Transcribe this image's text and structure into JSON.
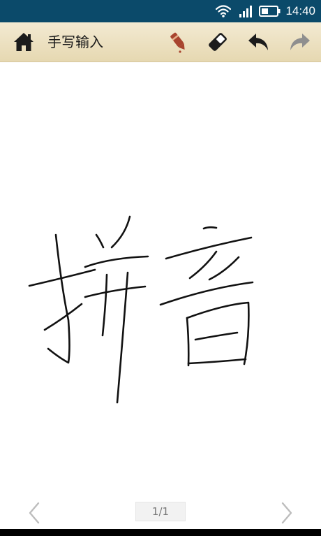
{
  "status_bar": {
    "time": "14:40",
    "icons": [
      "wifi-icon",
      "signal-icon",
      "battery-icon"
    ]
  },
  "toolbar": {
    "title": "手写输入",
    "buttons": [
      "home-icon",
      "pen-icon",
      "eraser-icon",
      "undo-icon",
      "redo-icon"
    ]
  },
  "canvas": {
    "handwriting": "拼音"
  },
  "footer": {
    "page_indicator": "1/1",
    "nav": [
      "previous-page-icon",
      "next-page-icon"
    ]
  },
  "colors": {
    "status_bar_bg": "#0b4a6a",
    "toolbar_bg": "#ece0bf",
    "pen_accent": "#a8442e",
    "stroke": "#111111",
    "disabled_icon": "#8f8f8f"
  }
}
